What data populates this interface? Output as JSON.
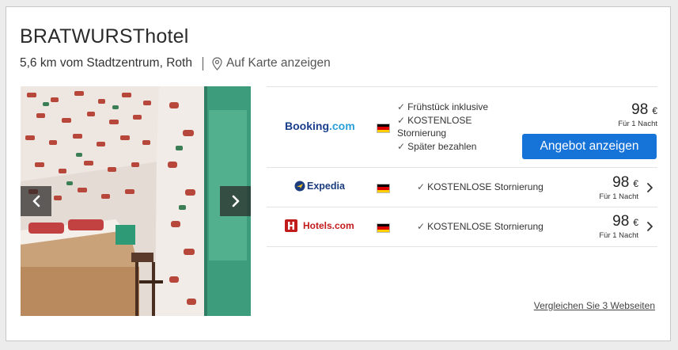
{
  "hotel": {
    "name": "BRATWURSThotel",
    "location": "5,6 km vom Stadtzentrum, Roth",
    "map_link": "Auf Karte anzeigen"
  },
  "photo": {
    "alt_icon_left": "chevron-left-icon",
    "alt_icon_right": "chevron-right-icon"
  },
  "offers": [
    {
      "provider": "Booking.com",
      "provider_name": "Booking",
      "provider_tld": ".com",
      "country_flag": "de-flag",
      "features": [
        "Frühstück inklusive",
        "KOSTENLOSE Stornierung",
        "Später bezahlen"
      ],
      "price": "98",
      "currency": "€",
      "per": "Für 1 Nacht",
      "cta": "Angebot anzeigen"
    },
    {
      "provider": "Expedia",
      "country_flag": "de-flag",
      "features": [
        "KOSTENLOSE Stornierung"
      ],
      "price": "98",
      "currency": "€",
      "per": "Für 1 Nacht"
    },
    {
      "provider": "Hotels.com",
      "country_flag": "de-flag",
      "features": [
        "KOSTENLOSE Stornierung"
      ],
      "price": "98",
      "currency": "€",
      "per": "Für 1 Nacht"
    }
  ],
  "compare_link": "Vergleichen Sie 3 Webseiten",
  "colors": {
    "cta": "#1673d8",
    "booking_blue": "#1a3e8c",
    "booking_dot": "#2aa0d8",
    "expedia_blue": "#1b3d7e",
    "expedia_yellow": "#f7c325",
    "hotels_red": "#c21b1b"
  }
}
